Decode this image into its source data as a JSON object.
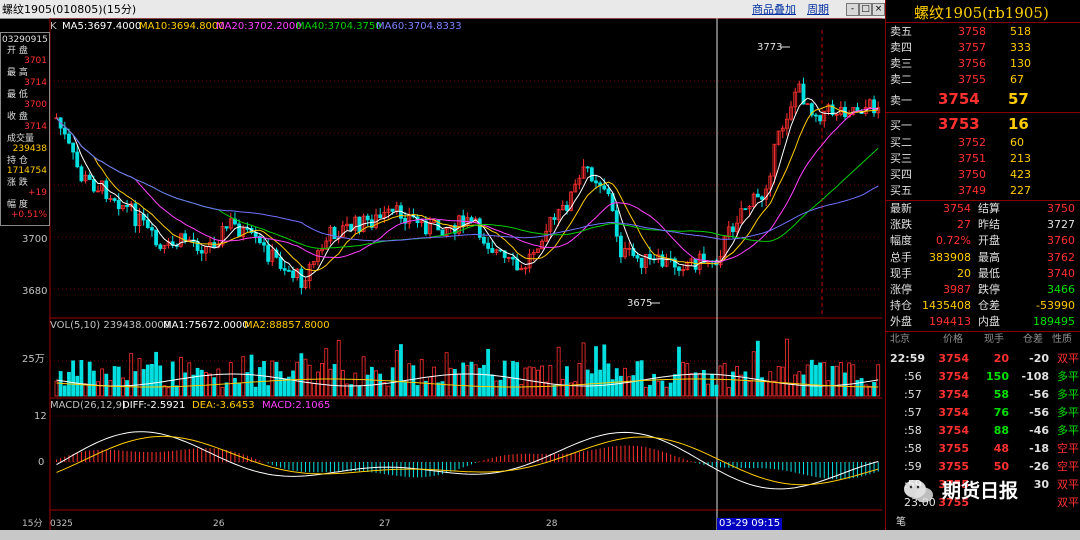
{
  "top": {
    "title": "螺纹1905(010805)(15分)",
    "link_product": "商品叠加",
    "link_period": "周期",
    "btn_min": "-",
    "btn_max": "□",
    "btn_close": "×"
  },
  "main": {
    "label": "K",
    "ma5": "MA5:3697.4000",
    "ma10": "MA10:3694.8000",
    "ma20": "MA20:3702.2000",
    "ma40": "MA40:3704.3750",
    "ma60": "MA60:3704.8333",
    "y3700": "3700",
    "y3680": "3680",
    "high_label": "3773",
    "low_label": "3675"
  },
  "infobox": {
    "date": "03290915",
    "open_label": "开 盘",
    "open": "3701",
    "high_label": "最 高",
    "high": "3714",
    "low_label": "最 低",
    "low": "3700",
    "close_label": "收 盘",
    "close": "3714",
    "vol_label": "成交量",
    "vol": "239438",
    "oi_label": "持 仓",
    "oi": "1714754",
    "chg_label": "涨 跌",
    "chg": "+19",
    "pct_label": "幅 度",
    "pct": "+0.51%"
  },
  "vol": {
    "label": "VOL(5,10) 239438.0000",
    "ma1": "MA1:75672.0000",
    "ma2": "MA2:88857.8000",
    "y25": "25万"
  },
  "macd": {
    "label": "MACD(26,12,9)",
    "diff": "DIFF:-2.5921",
    "dea": "DEA:-3.6453",
    "macd": "MACD:2.1065",
    "y12": "12",
    "y0": "0"
  },
  "xaxis": {
    "period": "15分",
    "d0325": "0325",
    "d26": "26",
    "d27": "27",
    "d28": "28",
    "cursor": "03-29 09:15"
  },
  "panel": {
    "title": "螺纹1905(rb1905)",
    "asks": [
      {
        "label": "卖五",
        "price": "3758",
        "vol": "518"
      },
      {
        "label": "卖四",
        "price": "3757",
        "vol": "333"
      },
      {
        "label": "卖三",
        "price": "3756",
        "vol": "130"
      },
      {
        "label": "卖二",
        "price": "3755",
        "vol": "67"
      },
      {
        "label": "卖一",
        "price": "3754",
        "vol": "57"
      }
    ],
    "bids": [
      {
        "label": "买一",
        "price": "3753",
        "vol": "16"
      },
      {
        "label": "买二",
        "price": "3752",
        "vol": "60"
      },
      {
        "label": "买三",
        "price": "3751",
        "vol": "213"
      },
      {
        "label": "买四",
        "price": "3750",
        "vol": "423"
      },
      {
        "label": "买五",
        "price": "3749",
        "vol": "227"
      }
    ],
    "stats": [
      {
        "l1": "最新",
        "v1": "3754",
        "c1": "red",
        "l2": "结算",
        "v2": "3750",
        "c2": "red"
      },
      {
        "l1": "涨跌",
        "v1": "27",
        "c1": "red",
        "l2": "昨结",
        "v2": "3727",
        "c2": "wht"
      },
      {
        "l1": "幅度",
        "v1": "0.72%",
        "c1": "red",
        "l2": "开盘",
        "v2": "3760",
        "c2": "red"
      },
      {
        "l1": "总手",
        "v1": "383908",
        "c1": "gold",
        "l2": "最高",
        "v2": "3762",
        "c2": "red"
      },
      {
        "l1": "现手",
        "v1": "20",
        "c1": "gold",
        "l2": "最低",
        "v2": "3740",
        "c2": "red"
      },
      {
        "l1": "涨停",
        "v1": "3987",
        "c1": "red",
        "l2": "跌停",
        "v2": "3466",
        "c2": "grn"
      },
      {
        "l1": "持仓",
        "v1": "1435408",
        "c1": "gold",
        "l2": "仓差",
        "v2": "-53990",
        "c2": "gold"
      },
      {
        "l1": "外盘",
        "v1": "194413",
        "c1": "red",
        "l2": "内盘",
        "v2": "189495",
        "c2": "grn"
      }
    ],
    "tick_header": {
      "c1": "北京",
      "c2": "价格",
      "c3": "现手",
      "c4": "仓差",
      "c5": "性质"
    },
    "ticks": [
      {
        "time": "22:59",
        "price": "3754",
        "vol": "20",
        "oi": "-20",
        "nature": "双平",
        "nc": "red"
      },
      {
        "time": ":56",
        "price": "3754",
        "vol": "150",
        "oi": "-108",
        "nature": "多平",
        "nc": "grn"
      },
      {
        "time": ":57",
        "price": "3754",
        "vol": "58",
        "oi": "-56",
        "nature": "多平",
        "nc": "grn"
      },
      {
        "time": ":57",
        "price": "3754",
        "vol": "76",
        "oi": "-56",
        "nature": "多平",
        "nc": "grn"
      },
      {
        "time": ":58",
        "price": "3754",
        "vol": "88",
        "oi": "-46",
        "nature": "多平",
        "nc": "grn"
      },
      {
        "time": ":58",
        "price": "3755",
        "vol": "48",
        "oi": "-18",
        "nature": "空平",
        "nc": "red"
      },
      {
        "time": ":59",
        "price": "3755",
        "vol": "50",
        "oi": "-26",
        "nature": "空平",
        "nc": "red"
      },
      {
        "time": ":59",
        "price": "3755",
        "vol": "",
        "oi": "30",
        "nature": "双平",
        "nc": "red"
      },
      {
        "time": "23:00",
        "price": "3755",
        "vol": "",
        "oi": "",
        "nature": "双平",
        "nc": "red"
      }
    ],
    "tab": "笔"
  },
  "watermark": "期货日报",
  "colors": {
    "up": "#ff3030",
    "down": "#00e0e0",
    "ma5": "#ffffff",
    "ma10": "#ffcc00",
    "ma20": "#ff40ff",
    "ma40": "#00d000",
    "ma60": "#7070ff",
    "grid": "#800000"
  }
}
